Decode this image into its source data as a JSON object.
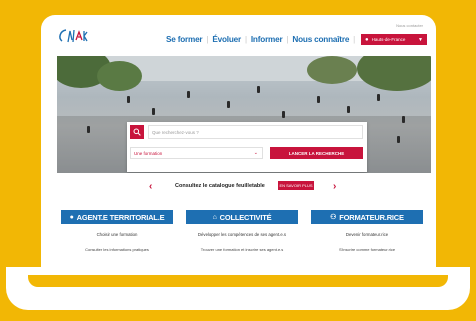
{
  "header": {
    "top_link": "Nous contacter",
    "nav": [
      "Se former",
      "Évoluer",
      "Informer",
      "Nous connaître"
    ],
    "region": "Hauts-de-France"
  },
  "search": {
    "placeholder": "Que recherchez-vous ?",
    "select_value": "Une formation",
    "button": "LANCER LA RECHERCHE"
  },
  "catalog": {
    "text": "Consultez le catalogue feuilletable",
    "more": "EN SAVOIR PLUS"
  },
  "cards": [
    {
      "title": "AGENT.E TERRITORIAL.E",
      "icon": "user-icon",
      "line1": "Choisir une formation",
      "line2": "Consulter les informations pratiques"
    },
    {
      "title": "COLLECTIVITÉ",
      "icon": "building-icon",
      "line1": "Développer les compétences de ses agent.e.s",
      "line2": "Trouver une formation et inscrire ses agent.e.s"
    },
    {
      "title": "FORMATEUR.RICE",
      "icon": "users-icon",
      "line1": "Devenir formateur.rice",
      "line2": "S'inscrire comme formateur.rice"
    }
  ],
  "colors": {
    "background": "#f2b705",
    "accent_red": "#c8143c",
    "accent_blue": "#1e6fb2"
  }
}
